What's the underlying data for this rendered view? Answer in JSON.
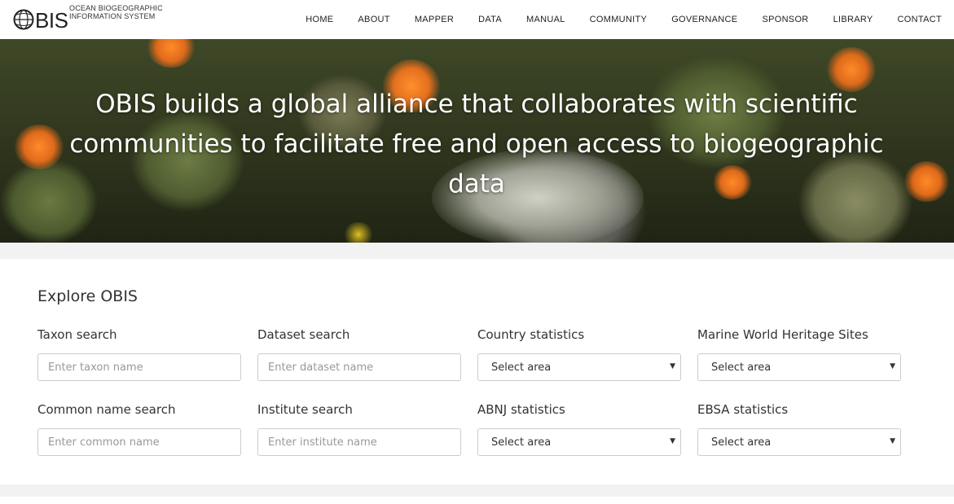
{
  "header": {
    "logo_text": "OBIS",
    "logo_sub_line1": "OCEAN BIOGEOGRAPHIC",
    "logo_sub_line2": "INFORMATION SYSTEM",
    "nav": [
      "HOME",
      "ABOUT",
      "MAPPER",
      "DATA",
      "MANUAL",
      "COMMUNITY",
      "GOVERNANCE",
      "SPONSOR",
      "LIBRARY",
      "CONTACT"
    ]
  },
  "hero": {
    "line1": "OBIS builds a global alliance that collaborates with scientific",
    "line2": "communities to facilitate free and open access to biogeographic",
    "line3": "data"
  },
  "explore": {
    "title": "Explore OBIS",
    "taxon": {
      "label": "Taxon search",
      "placeholder": "Enter taxon name"
    },
    "dataset": {
      "label": "Dataset search",
      "placeholder": "Enter dataset name"
    },
    "country": {
      "label": "Country statistics",
      "value": "Select area"
    },
    "heritage": {
      "label": "Marine World Heritage Sites",
      "value": "Select area"
    },
    "common": {
      "label": "Common name search",
      "placeholder": "Enter common name"
    },
    "institute": {
      "label": "Institute search",
      "placeholder": "Enter institute name"
    },
    "abnj": {
      "label": "ABNJ statistics",
      "value": "Select area"
    },
    "ebsa": {
      "label": "EBSA statistics",
      "value": "Select area"
    }
  },
  "colors": {
    "header_bg": "#ffffff",
    "page_bg": "#f2f2f2",
    "hero_text": "#ffffff",
    "body_text": "#333333",
    "border": "#cccccc"
  }
}
